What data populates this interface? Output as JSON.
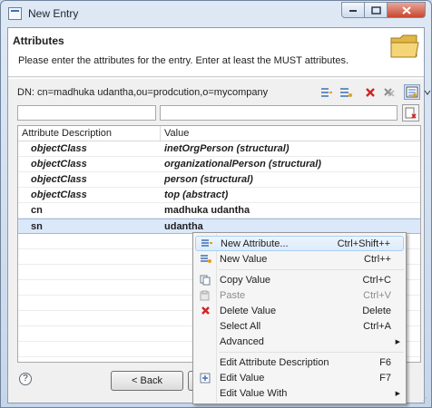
{
  "window": {
    "title": "New Entry"
  },
  "header": {
    "title": "Attributes",
    "description": "Please enter the attributes for the entry. Enter at least the MUST attributes."
  },
  "dn": {
    "label": "DN: cn=madhuka udantha,ou=prodcution,o=mycompany"
  },
  "filters": {
    "attribute_filter": "",
    "value_filter": ""
  },
  "table": {
    "columns": [
      "Attribute Description",
      "Value"
    ],
    "rows": [
      {
        "attribute": "objectClass",
        "value": "inetOrgPerson (structural)",
        "italic": true
      },
      {
        "attribute": "objectClass",
        "value": "organizationalPerson (structural)",
        "italic": true
      },
      {
        "attribute": "objectClass",
        "value": "person (structural)",
        "italic": true
      },
      {
        "attribute": "objectClass",
        "value": "top (abstract)",
        "italic": true
      },
      {
        "attribute": "cn",
        "value": "madhuka udantha",
        "italic": false
      },
      {
        "attribute": "sn",
        "value": "udantha",
        "italic": false,
        "selected": true
      }
    ]
  },
  "buttons": {
    "back": "< Back"
  },
  "context_menu": {
    "items": [
      {
        "label": "New Attribute...",
        "shortcut": "Ctrl+Shift++",
        "icon": "new-attribute-icon"
      },
      {
        "label": "New Value",
        "shortcut": "Ctrl++",
        "icon": "new-value-icon"
      },
      {
        "label": "Copy Value",
        "shortcut": "Ctrl+C",
        "icon": "copy-icon"
      },
      {
        "label": "Paste",
        "shortcut": "Ctrl+V",
        "icon": "paste-icon",
        "disabled": true
      },
      {
        "label": "Delete Value",
        "shortcut": "Delete",
        "icon": "delete-icon"
      },
      {
        "label": "Select All",
        "shortcut": "Ctrl+A"
      },
      {
        "label": "Advanced",
        "submenu": true
      },
      {
        "label": "Edit Attribute Description",
        "shortcut": "F6"
      },
      {
        "label": "Edit Value",
        "shortcut": "F7",
        "icon": "edit-value-icon"
      },
      {
        "label": "Edit Value With",
        "submenu": true
      }
    ]
  },
  "colors": {
    "accent": "#3f6fb3",
    "selection": "#dbe8fa",
    "delete": "#d02424"
  }
}
